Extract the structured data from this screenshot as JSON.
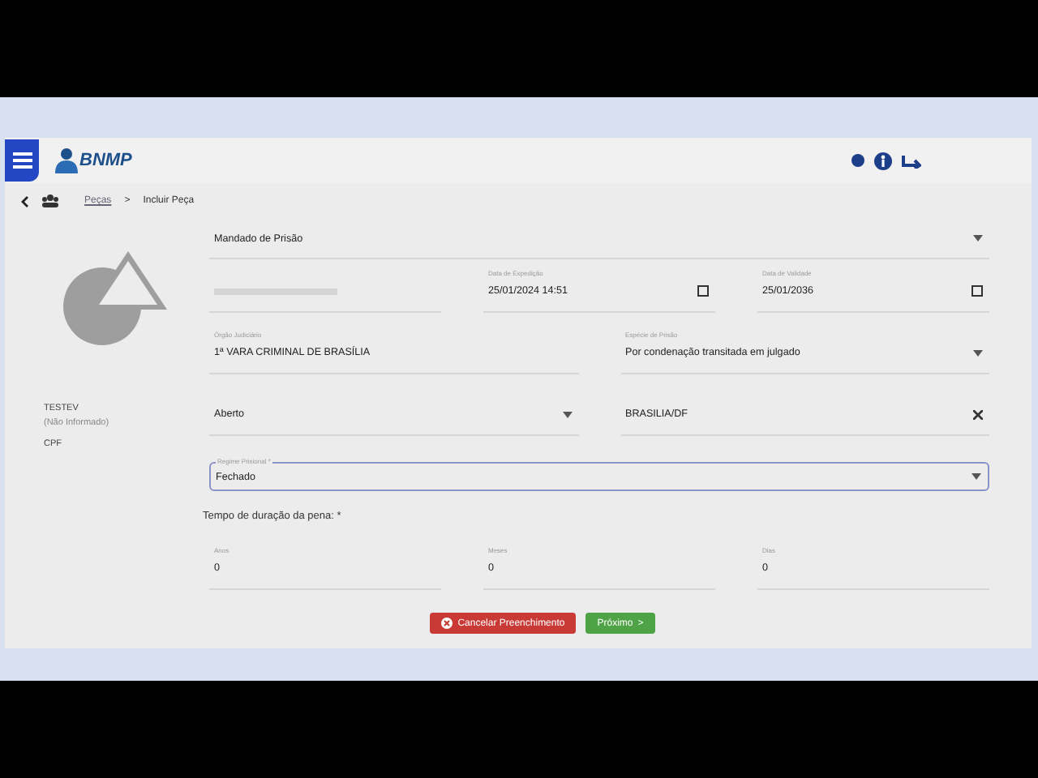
{
  "header": {
    "logo": "BNMP"
  },
  "breadcrumb": {
    "link": "Peças",
    "separator": ">",
    "current": "Incluir Peça"
  },
  "person": {
    "name": "TESTEV",
    "subtitle": "(Não Informado)",
    "cpf_label": "CPF"
  },
  "rows": [
    {
      "fields": [
        {
          "kind": "select",
          "value": "Mandado de Prisão"
        }
      ]
    },
    {
      "fields": [
        {
          "kind": "text"
        },
        {
          "kind": "date",
          "label": "Data de Expedição",
          "value": "25/01/2024 14:51"
        },
        {
          "kind": "date",
          "label": "Data de Validade",
          "value": "25/01/2036"
        }
      ]
    },
    {
      "fields": [
        {
          "kind": "text",
          "label": "Órgão Judiciário",
          "value": "1ª VARA CRIMINAL DE BRASÍLIA"
        },
        {
          "kind": "select",
          "label": "Espécie de Prisão",
          "value": "Por condenação transitada em julgado"
        }
      ]
    },
    {
      "fields": [
        {
          "kind": "select",
          "value": "Aberto"
        },
        {
          "kind": "clear",
          "value": "BRASILIA/DF"
        }
      ]
    },
    {
      "fields": [
        {
          "kind": "outlined",
          "label": "Regime Prisional *",
          "value": "Fechado"
        }
      ]
    }
  ],
  "duration": {
    "title": "Tempo de duração da pena: *",
    "fields": [
      {
        "label": "Anos",
        "value": "0"
      },
      {
        "label": "Meses",
        "value": "0"
      },
      {
        "label": "Dias",
        "value": "0"
      }
    ]
  },
  "buttons": [
    {
      "kind": "cancel",
      "label": "Cancelar Preenchimento"
    },
    {
      "kind": "next",
      "label": "Próximo",
      "arrow": ">"
    }
  ]
}
